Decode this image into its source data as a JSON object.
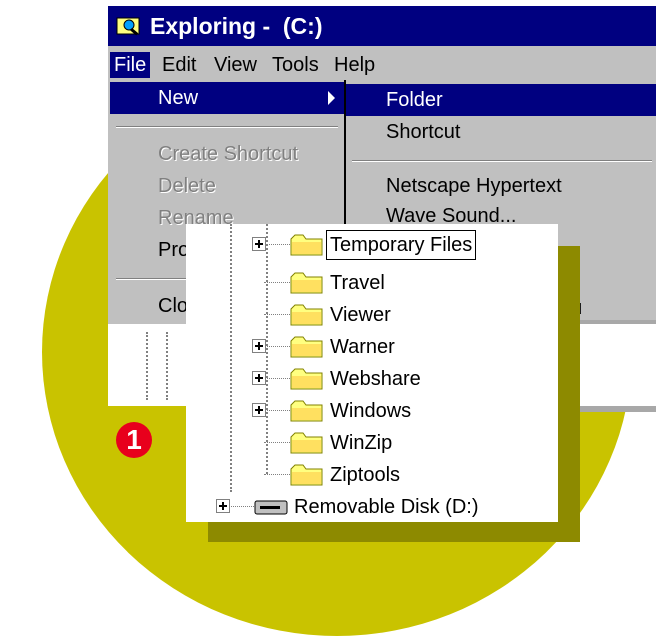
{
  "window": {
    "title": "Exploring -  (C:)"
  },
  "menubar": {
    "items": [
      {
        "label": "File"
      },
      {
        "label": "Edit"
      },
      {
        "label": "View"
      },
      {
        "label": "Tools"
      },
      {
        "label": "Help"
      }
    ]
  },
  "file_menu": {
    "items": [
      {
        "label": "New",
        "highlighted": true,
        "has_submenu": true
      },
      {
        "label": "Create Shortcut",
        "disabled": true
      },
      {
        "label": "Delete",
        "disabled": true
      },
      {
        "label": "Rename",
        "disabled": true
      },
      {
        "label": "Pro"
      },
      {
        "label": "Clo"
      }
    ]
  },
  "new_submenu": {
    "items": [
      {
        "label": "Folder",
        "highlighted": true
      },
      {
        "label": "Shortcut"
      },
      {
        "label": "Netscape Hypertext"
      },
      {
        "label": "Wave Sound..."
      }
    ],
    "partial_text": "ocu"
  },
  "tree": {
    "items": [
      {
        "label": "Temporary Files",
        "expandable": true,
        "selected": true
      },
      {
        "label": "Travel",
        "expandable": false
      },
      {
        "label": "Viewer",
        "expandable": false
      },
      {
        "label": "Warner",
        "expandable": true
      },
      {
        "label": "Webshare",
        "expandable": true
      },
      {
        "label": "Windows",
        "expandable": true
      },
      {
        "label": "WinZip",
        "expandable": false
      },
      {
        "label": "Ziptools",
        "expandable": false
      }
    ],
    "drive": {
      "label": "Removable Disk (D:)",
      "expandable": true
    }
  },
  "callout": {
    "number": "1"
  },
  "colors": {
    "circle": "#c9c300",
    "titlebar": "#000080",
    "menu_bg": "#c0c0c0",
    "badge": "#e8001c"
  }
}
